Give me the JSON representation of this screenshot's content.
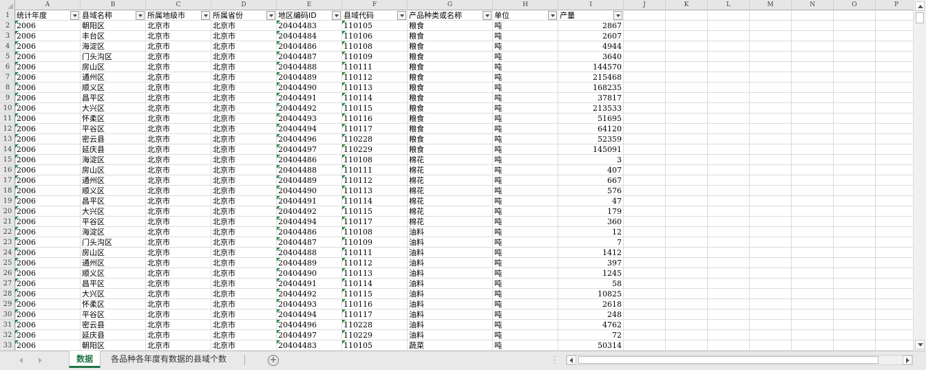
{
  "columns": [
    "A",
    "B",
    "C",
    "D",
    "E",
    "F",
    "G",
    "H",
    "I",
    "J",
    "K",
    "L",
    "M",
    "N",
    "O",
    "P"
  ],
  "header_row": {
    "row_number": "1",
    "labels": [
      "统计年度",
      "县域名称",
      "所属地级市",
      "所属省份",
      "地区编码ID",
      "县域代码",
      "产品种类或名称",
      "单位",
      "产量"
    ]
  },
  "rows": [
    {
      "n": "2",
      "year": "2006",
      "county": "朝阳区",
      "city": "北京市",
      "province": "北京市",
      "area_id": "20404483",
      "county_code": "110105",
      "product": "粮食",
      "unit": "吨",
      "output": "2867"
    },
    {
      "n": "3",
      "year": "2006",
      "county": "丰台区",
      "city": "北京市",
      "province": "北京市",
      "area_id": "20404484",
      "county_code": "110106",
      "product": "粮食",
      "unit": "吨",
      "output": "2607"
    },
    {
      "n": "4",
      "year": "2006",
      "county": "海淀区",
      "city": "北京市",
      "province": "北京市",
      "area_id": "20404486",
      "county_code": "110108",
      "product": "粮食",
      "unit": "吨",
      "output": "4944"
    },
    {
      "n": "5",
      "year": "2006",
      "county": "门头沟区",
      "city": "北京市",
      "province": "北京市",
      "area_id": "20404487",
      "county_code": "110109",
      "product": "粮食",
      "unit": "吨",
      "output": "3640"
    },
    {
      "n": "6",
      "year": "2006",
      "county": "房山区",
      "city": "北京市",
      "province": "北京市",
      "area_id": "20404488",
      "county_code": "110111",
      "product": "粮食",
      "unit": "吨",
      "output": "144570"
    },
    {
      "n": "7",
      "year": "2006",
      "county": "通州区",
      "city": "北京市",
      "province": "北京市",
      "area_id": "20404489",
      "county_code": "110112",
      "product": "粮食",
      "unit": "吨",
      "output": "215468"
    },
    {
      "n": "8",
      "year": "2006",
      "county": "顺义区",
      "city": "北京市",
      "province": "北京市",
      "area_id": "20404490",
      "county_code": "110113",
      "product": "粮食",
      "unit": "吨",
      "output": "168235"
    },
    {
      "n": "9",
      "year": "2006",
      "county": "昌平区",
      "city": "北京市",
      "province": "北京市",
      "area_id": "20404491",
      "county_code": "110114",
      "product": "粮食",
      "unit": "吨",
      "output": "37817"
    },
    {
      "n": "10",
      "year": "2006",
      "county": "大兴区",
      "city": "北京市",
      "province": "北京市",
      "area_id": "20404492",
      "county_code": "110115",
      "product": "粮食",
      "unit": "吨",
      "output": "213533"
    },
    {
      "n": "11",
      "year": "2006",
      "county": "怀柔区",
      "city": "北京市",
      "province": "北京市",
      "area_id": "20404493",
      "county_code": "110116",
      "product": "粮食",
      "unit": "吨",
      "output": "51695"
    },
    {
      "n": "12",
      "year": "2006",
      "county": "平谷区",
      "city": "北京市",
      "province": "北京市",
      "area_id": "20404494",
      "county_code": "110117",
      "product": "粮食",
      "unit": "吨",
      "output": "64120"
    },
    {
      "n": "13",
      "year": "2006",
      "county": "密云县",
      "city": "北京市",
      "province": "北京市",
      "area_id": "20404496",
      "county_code": "110228",
      "product": "粮食",
      "unit": "吨",
      "output": "52359"
    },
    {
      "n": "14",
      "year": "2006",
      "county": "延庆县",
      "city": "北京市",
      "province": "北京市",
      "area_id": "20404497",
      "county_code": "110229",
      "product": "粮食",
      "unit": "吨",
      "output": "145091"
    },
    {
      "n": "15",
      "year": "2006",
      "county": "海淀区",
      "city": "北京市",
      "province": "北京市",
      "area_id": "20404486",
      "county_code": "110108",
      "product": "棉花",
      "unit": "吨",
      "output": "3"
    },
    {
      "n": "16",
      "year": "2006",
      "county": "房山区",
      "city": "北京市",
      "province": "北京市",
      "area_id": "20404488",
      "county_code": "110111",
      "product": "棉花",
      "unit": "吨",
      "output": "407"
    },
    {
      "n": "17",
      "year": "2006",
      "county": "通州区",
      "city": "北京市",
      "province": "北京市",
      "area_id": "20404489",
      "county_code": "110112",
      "product": "棉花",
      "unit": "吨",
      "output": "667"
    },
    {
      "n": "18",
      "year": "2006",
      "county": "顺义区",
      "city": "北京市",
      "province": "北京市",
      "area_id": "20404490",
      "county_code": "110113",
      "product": "棉花",
      "unit": "吨",
      "output": "576"
    },
    {
      "n": "19",
      "year": "2006",
      "county": "昌平区",
      "city": "北京市",
      "province": "北京市",
      "area_id": "20404491",
      "county_code": "110114",
      "product": "棉花",
      "unit": "吨",
      "output": "47"
    },
    {
      "n": "20",
      "year": "2006",
      "county": "大兴区",
      "city": "北京市",
      "province": "北京市",
      "area_id": "20404492",
      "county_code": "110115",
      "product": "棉花",
      "unit": "吨",
      "output": "179"
    },
    {
      "n": "21",
      "year": "2006",
      "county": "平谷区",
      "city": "北京市",
      "province": "北京市",
      "area_id": "20404494",
      "county_code": "110117",
      "product": "棉花",
      "unit": "吨",
      "output": "360"
    },
    {
      "n": "22",
      "year": "2006",
      "county": "海淀区",
      "city": "北京市",
      "province": "北京市",
      "area_id": "20404486",
      "county_code": "110108",
      "product": "油料",
      "unit": "吨",
      "output": "12"
    },
    {
      "n": "23",
      "year": "2006",
      "county": "门头沟区",
      "city": "北京市",
      "province": "北京市",
      "area_id": "20404487",
      "county_code": "110109",
      "product": "油料",
      "unit": "吨",
      "output": "7"
    },
    {
      "n": "24",
      "year": "2006",
      "county": "房山区",
      "city": "北京市",
      "province": "北京市",
      "area_id": "20404488",
      "county_code": "110111",
      "product": "油料",
      "unit": "吨",
      "output": "1412"
    },
    {
      "n": "25",
      "year": "2006",
      "county": "通州区",
      "city": "北京市",
      "province": "北京市",
      "area_id": "20404489",
      "county_code": "110112",
      "product": "油料",
      "unit": "吨",
      "output": "397"
    },
    {
      "n": "26",
      "year": "2006",
      "county": "顺义区",
      "city": "北京市",
      "province": "北京市",
      "area_id": "20404490",
      "county_code": "110113",
      "product": "油料",
      "unit": "吨",
      "output": "1245"
    },
    {
      "n": "27",
      "year": "2006",
      "county": "昌平区",
      "city": "北京市",
      "province": "北京市",
      "area_id": "20404491",
      "county_code": "110114",
      "product": "油料",
      "unit": "吨",
      "output": "58"
    },
    {
      "n": "28",
      "year": "2006",
      "county": "大兴区",
      "city": "北京市",
      "province": "北京市",
      "area_id": "20404492",
      "county_code": "110115",
      "product": "油料",
      "unit": "吨",
      "output": "10825"
    },
    {
      "n": "29",
      "year": "2006",
      "county": "怀柔区",
      "city": "北京市",
      "province": "北京市",
      "area_id": "20404493",
      "county_code": "110116",
      "product": "油料",
      "unit": "吨",
      "output": "2618"
    },
    {
      "n": "30",
      "year": "2006",
      "county": "平谷区",
      "city": "北京市",
      "province": "北京市",
      "area_id": "20404494",
      "county_code": "110117",
      "product": "油料",
      "unit": "吨",
      "output": "248"
    },
    {
      "n": "31",
      "year": "2006",
      "county": "密云县",
      "city": "北京市",
      "province": "北京市",
      "area_id": "20404496",
      "county_code": "110228",
      "product": "油料",
      "unit": "吨",
      "output": "4762"
    },
    {
      "n": "32",
      "year": "2006",
      "county": "延庆县",
      "city": "北京市",
      "province": "北京市",
      "area_id": "20404497",
      "county_code": "110229",
      "product": "油料",
      "unit": "吨",
      "output": "72"
    },
    {
      "n": "33",
      "year": "2006",
      "county": "朝阳区",
      "city": "北京市",
      "province": "北京市",
      "area_id": "20404483",
      "county_code": "110105",
      "product": "蔬菜",
      "unit": "吨",
      "output": "50314"
    }
  ],
  "sheet_tabs": [
    {
      "label": "数据",
      "active": true
    },
    {
      "label": "各品种各年度有数据的县域个数",
      "active": false
    }
  ],
  "add_sheet_label": "+",
  "colors": {
    "accent": "#217346",
    "text_indicator": "#1f8a3b",
    "header_bg": "#e6e6e6",
    "gridline": "#dadcdd"
  }
}
